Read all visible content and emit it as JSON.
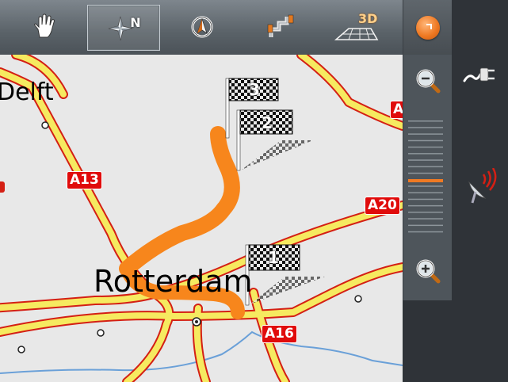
{
  "toolbar": {
    "buttons": [
      {
        "name": "hand-icon",
        "label": ""
      },
      {
        "name": "compass-north-icon",
        "label": "N"
      },
      {
        "name": "compass-heading-icon",
        "label": ""
      },
      {
        "name": "route-icon",
        "label": ""
      },
      {
        "name": "3d-view-icon",
        "label": "3D"
      }
    ],
    "active_index": 1
  },
  "menu": {
    "icon": "orange-menu-orb-icon",
    "color": "#ef7a24"
  },
  "map": {
    "background": "#e8e8e8",
    "cities": [
      {
        "name": "Delft"
      },
      {
        "name": "Rotterdam"
      }
    ],
    "road_badges": [
      "A13",
      "A20",
      "A16",
      "A"
    ],
    "waypoints": [
      {
        "number": "1"
      },
      {
        "number": "2"
      },
      {
        "number": "3"
      }
    ],
    "route_color": "#f7861c",
    "road_color": "#f6ea60",
    "road_outline_color": "#d41f14",
    "water_color": "#6aa0d8"
  },
  "zoom": {
    "zoom_out_icon": "zoom-out-icon",
    "zoom_in_icon": "zoom-in-icon",
    "level_fraction": 0.55,
    "level_color": "#ef7a24"
  },
  "right_panel": {
    "icons": [
      "gps-plug-icon",
      "satellite-dish-icon"
    ]
  }
}
